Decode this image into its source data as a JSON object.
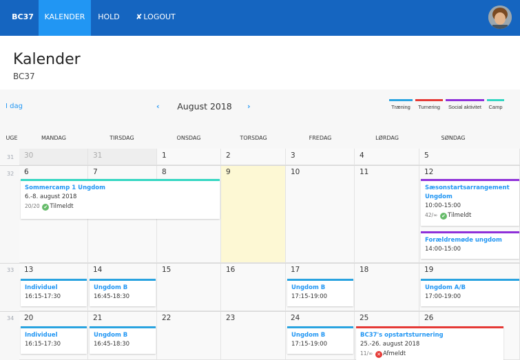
{
  "nav": {
    "brand": "BC37",
    "items": [
      {
        "label": "KALENDER"
      },
      {
        "label": "HOLD"
      },
      {
        "label": "LOGOUT",
        "icon": "x-icon"
      }
    ]
  },
  "page": {
    "title": "Kalender",
    "subtitle": "BC37"
  },
  "calendar": {
    "today_label": "I dag",
    "month_label": "August 2018",
    "legend": [
      {
        "label": "Træning",
        "color": "#29a3e0"
      },
      {
        "label": "Turnering",
        "color": "#e53935"
      },
      {
        "label": "Social aktivitet",
        "color": "#8e2fd9"
      },
      {
        "label": "Camp",
        "color": "#32d6c2"
      }
    ],
    "week_header": "UGE",
    "weekdays": [
      "MANDAG",
      "TIRSDAG",
      "ONSDAG",
      "TORSDAG",
      "FREDAG",
      "LØRDAG",
      "SØNDAG"
    ],
    "weeks": [
      {
        "number": "31",
        "days": [
          "30",
          "31",
          "1",
          "2",
          "3",
          "4",
          "5"
        ]
      },
      {
        "number": "32",
        "days": [
          "6",
          "7",
          "8",
          "9",
          "10",
          "11",
          "12"
        ]
      },
      {
        "number": "33",
        "days": [
          "13",
          "14",
          "15",
          "16",
          "17",
          "18",
          "19"
        ]
      },
      {
        "number": "34",
        "days": [
          "20",
          "21",
          "22",
          "23",
          "24",
          "25",
          "26"
        ]
      }
    ],
    "events": {
      "sommercamp": {
        "title": "Sommercamp 1 Ungdom",
        "time": "6.-8. august 2018",
        "count": "20/20",
        "status": "Tilmeldt"
      },
      "saesonstart": {
        "title": "Sæsonstartsarrangement Ungdom",
        "time": "10:00-15:00",
        "count": "42/∞",
        "status": "Tilmeldt"
      },
      "foraeldremode": {
        "title": "Forældremøde ungdom",
        "time": "14:00-15:00"
      },
      "individuel_13": {
        "title": "Individuel",
        "time": "16:15-17:30"
      },
      "ungdomb_14": {
        "title": "Ungdom B",
        "time": "16:45-18:30"
      },
      "ungdomb_17": {
        "title": "Ungdom B",
        "time": "17:15-19:00"
      },
      "ungdomab_19": {
        "title": "Ungdom A/B",
        "time": "17:00-19:00"
      },
      "individuel_20": {
        "title": "Individuel",
        "time": "16:15-17:30"
      },
      "ungdomb_21": {
        "title": "Ungdom B",
        "time": "16:45-18:30"
      },
      "ungdomb_24": {
        "title": "Ungdom B",
        "time": "17:15-19:00"
      },
      "opstart": {
        "title": "BC37's opstartsturnering",
        "time": "25.-26. august 2018",
        "count": "11/∞",
        "status": "Afmeldt"
      }
    }
  }
}
